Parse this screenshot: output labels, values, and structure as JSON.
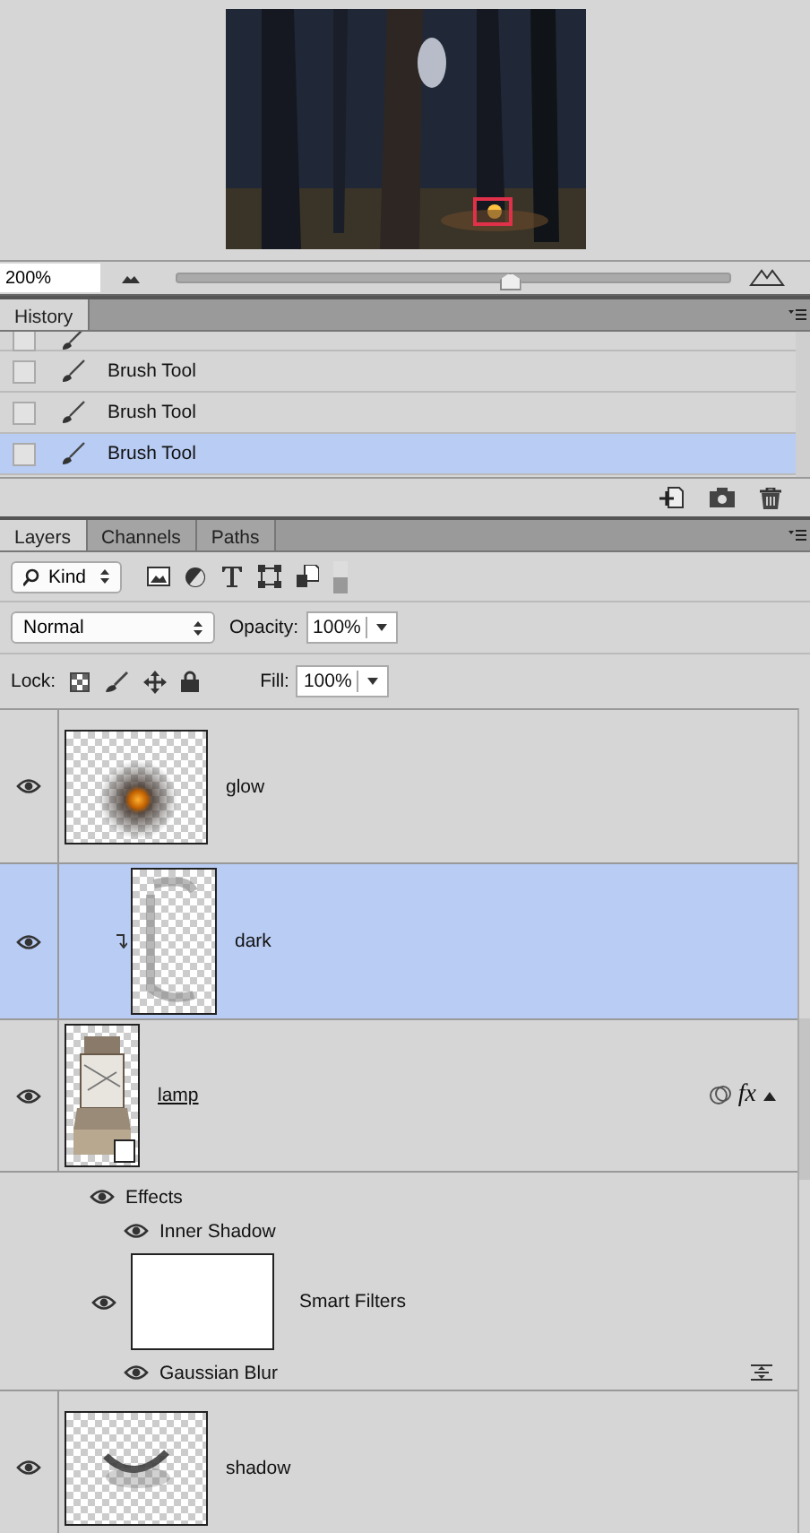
{
  "navigator": {
    "zoom": "200%",
    "zoom_slider": {
      "level": 0.6
    }
  },
  "history": {
    "tab": "History",
    "items": [
      {
        "kind": "partial",
        "checked": false,
        "selected": false
      },
      {
        "kind": "step",
        "label": "Brush Tool",
        "checked": false,
        "selected": false
      },
      {
        "kind": "step",
        "label": "Brush Tool",
        "checked": false,
        "selected": false
      },
      {
        "kind": "step",
        "label": "Brush Tool",
        "checked": false,
        "selected": true
      }
    ]
  },
  "layers_panel": {
    "tabs": [
      {
        "label": "Layers",
        "selected": true
      },
      {
        "label": "Channels",
        "selected": false
      },
      {
        "label": "Paths",
        "selected": false
      }
    ],
    "filter": "Kind",
    "blend_mode": "Normal",
    "opacity_label": "Opacity:",
    "opacity": "100%",
    "lock_label": "Lock:",
    "fill_label": "Fill:",
    "fill": "100%",
    "layers": [
      {
        "name": "glow",
        "visible": true,
        "selected": false,
        "clipped": false
      },
      {
        "name": "dark",
        "visible": true,
        "selected": true,
        "clipped": true
      },
      {
        "name": "lamp",
        "visible": true,
        "selected": false,
        "clipped": false,
        "linked": true,
        "fx": "fx",
        "effects": {
          "label": "Effects",
          "visible": true,
          "children": [
            {
              "label": "Inner Shadow",
              "visible": true
            }
          ]
        },
        "smart_filters": {
          "label": "Smart Filters",
          "visible": true,
          "children": [
            {
              "label": "Gaussian Blur",
              "visible": true
            }
          ]
        }
      },
      {
        "name": "shadow",
        "visible": true,
        "selected": false,
        "clipped": false
      }
    ]
  }
}
